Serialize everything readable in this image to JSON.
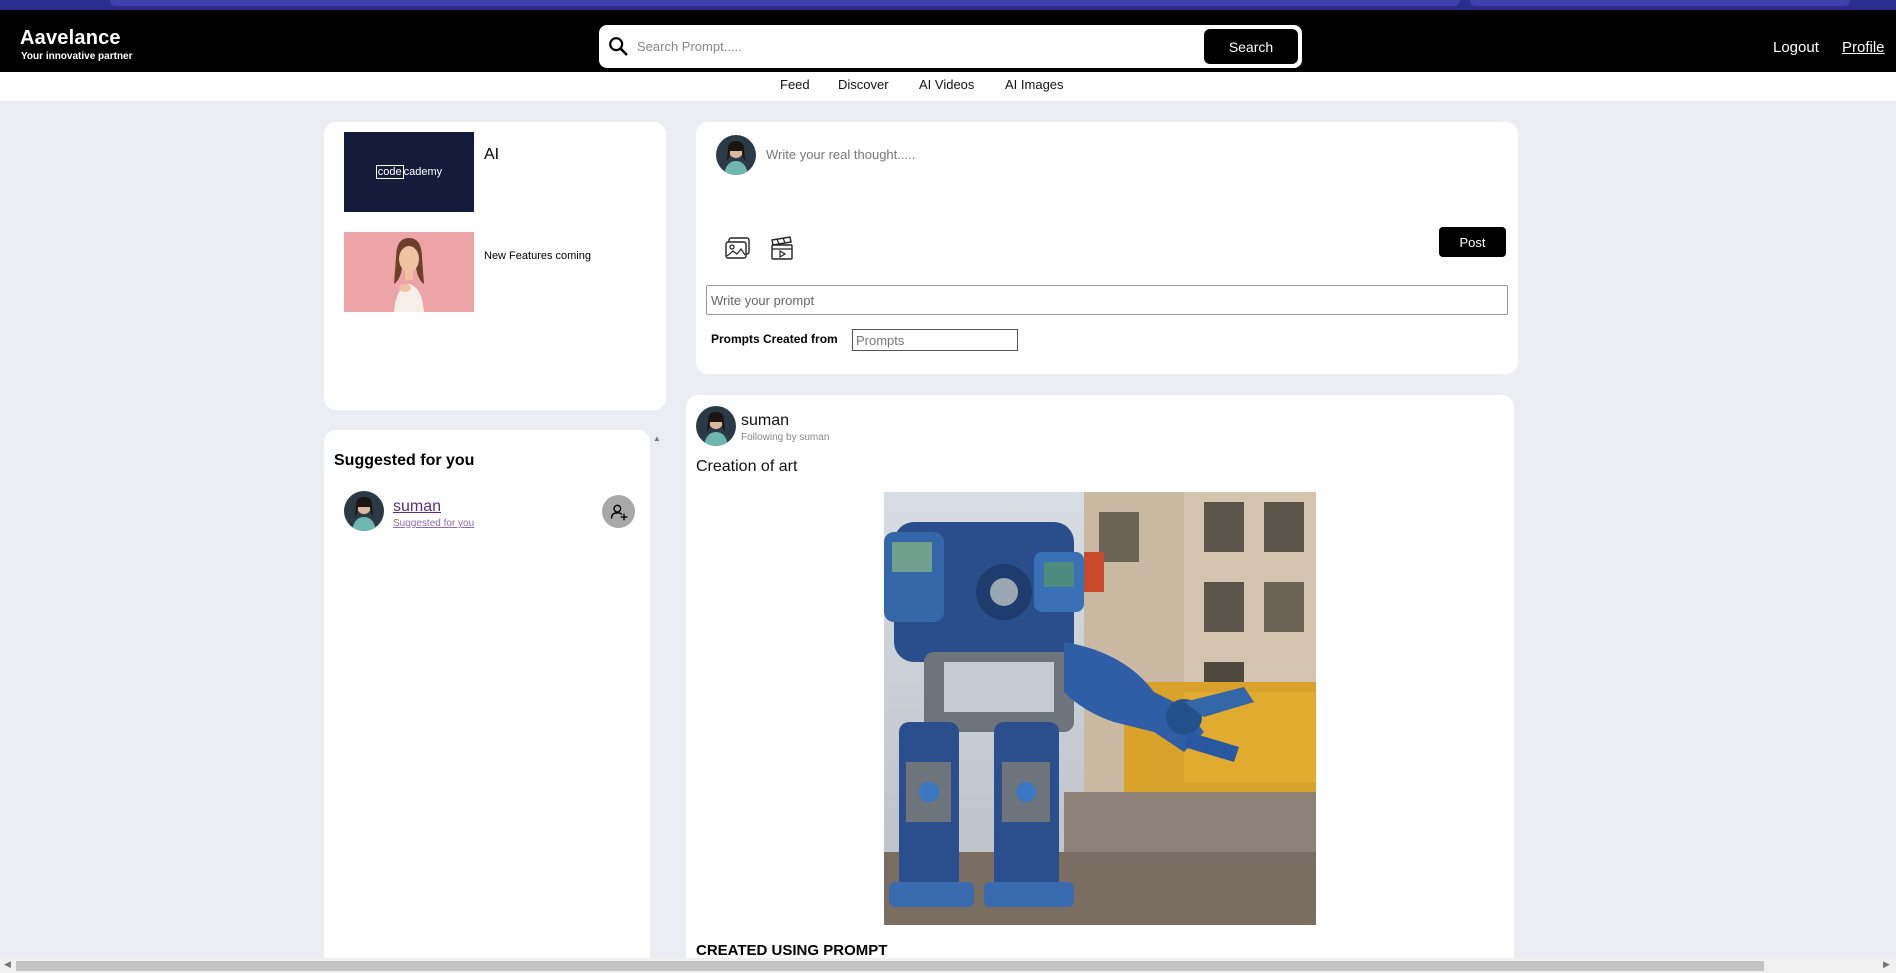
{
  "brand": {
    "name": "Aavelance",
    "tagline": "Your innovative partner"
  },
  "search": {
    "placeholder": "Search Prompt.....",
    "button_label": "Search",
    "icon": "search-icon"
  },
  "header_links": {
    "logout": "Logout",
    "profile": "Profile"
  },
  "nav": {
    "items": [
      {
        "label": "Feed"
      },
      {
        "label": "Discover"
      },
      {
        "label": "AI Videos"
      },
      {
        "label": "AI Images"
      }
    ]
  },
  "ads": [
    {
      "logo_text_boxed": "code",
      "logo_text": "cademy",
      "title": "AI"
    },
    {
      "title": "New Features coming"
    }
  ],
  "suggested": {
    "title": "Suggested for you",
    "items": [
      {
        "name": "suman",
        "subtitle": "Suggested for you",
        "action_icon": "add-user-icon"
      }
    ]
  },
  "compose": {
    "thought_placeholder": "Write your real thought.....",
    "image_icon": "image-icon",
    "video_icon": "clapperboard-icon",
    "post_label": "Post",
    "prompt_placeholder": "Write your prompt",
    "prompts_label": "Prompts Created from",
    "prompts_source_placeholder": "Prompts"
  },
  "feed": {
    "posts": [
      {
        "author": "suman",
        "following_text": "Following by suman",
        "caption": "Creation of art",
        "image_description": "robot-art",
        "prompt_heading": "CREATED USING PROMPT"
      }
    ]
  },
  "colors": {
    "topbar": "#000000",
    "page_background": "#eaedf2",
    "card": "#ffffff",
    "button_dark": "#000000",
    "follow_button": "#a8a8a8"
  }
}
